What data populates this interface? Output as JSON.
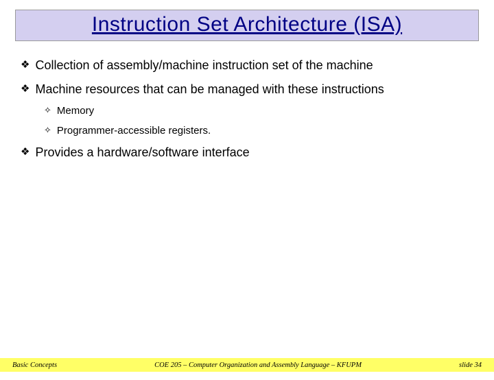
{
  "title": "Instruction Set Architecture (ISA)",
  "bullets": [
    {
      "level": 1,
      "text": "Collection of assembly/machine instruction set of the machine"
    },
    {
      "level": 1,
      "text": "Machine resources that can be managed with these instructions"
    },
    {
      "level": 2,
      "text": "Memory"
    },
    {
      "level": 2,
      "text": "Programmer-accessible registers."
    },
    {
      "level": 1,
      "text": "Provides a hardware/software interface"
    }
  ],
  "footer": {
    "left": "Basic Concepts",
    "center": "COE 205 – Computer Organization and Assembly Language – KFUPM",
    "right": "slide 34"
  },
  "glyphs": {
    "l1": "❖",
    "l2": "✧"
  }
}
